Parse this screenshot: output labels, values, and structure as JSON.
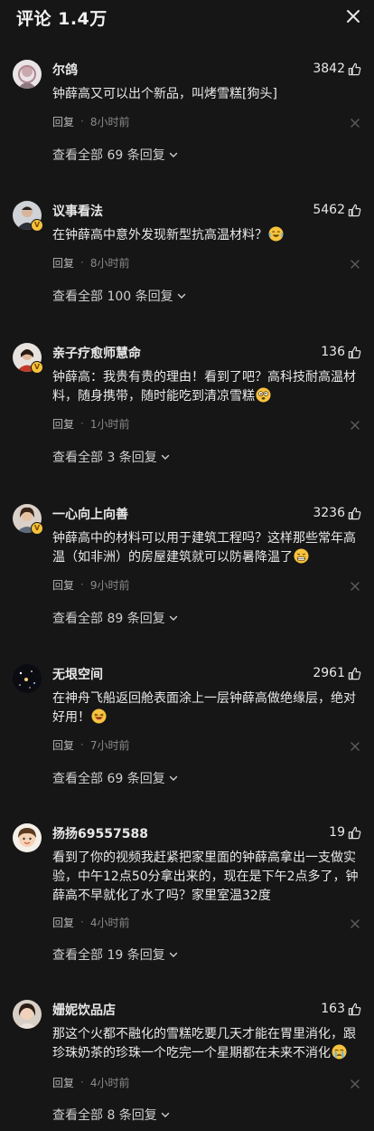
{
  "header": {
    "title": "评论 1.4万"
  },
  "labels": {
    "reply": "回复",
    "dot": "·"
  },
  "comments": [
    {
      "user": "尔鸽",
      "likes": "3842",
      "text": "钟薛高又可以出个新品，叫烤雪糕[狗头]",
      "time": "8小时前",
      "view_all": "查看全部 69 条回复",
      "emoji": "",
      "verified": false
    },
    {
      "user": "议事看法",
      "likes": "5462",
      "text": "在钟薛高中意外发现新型抗高温材料？",
      "time": "8小时前",
      "view_all": "查看全部 100 条回复",
      "emoji": "laughing-crying-emoji",
      "verified": true
    },
    {
      "user": "亲子疗愈师慧命",
      "likes": "136",
      "text": "钟薛高：我贵有贵的理由！看到了吧？高科技耐高温材料，随身携带，随时能吃到清凉雪糕",
      "time": "1小时前",
      "view_all": "查看全部 3 条回复",
      "emoji": "dizzy-emoji",
      "verified": true
    },
    {
      "user": "一心向上向善",
      "likes": "3236",
      "text": "钟薛高中的材料可以用于建筑工程吗？这样那些常年高温（如非洲）的房屋建筑就可以防暑降温了",
      "time": "9小时前",
      "view_all": "查看全部 89 条回复",
      "emoji": "grin-emoji",
      "verified": true
    },
    {
      "user": "无垠空间",
      "likes": "2961",
      "text": "在神舟飞船返回舱表面涂上一层钟薛高做绝缘层，绝对好用！",
      "time": "7小时前",
      "view_all": "查看全部 69 条回复",
      "emoji": "laughing-emoji",
      "verified": false
    },
    {
      "user": "扬扬69557588",
      "likes": "19",
      "text": "看到了你的视频我赶紧把家里面的钟薛高拿出一支做实验，中午12点50分拿出来的，现在是下午2点多了，钟薛高不早就化了水了吗？家里室温32度",
      "time": "4小时前",
      "view_all": "查看全部 19 条回复",
      "emoji": "",
      "verified": false
    },
    {
      "user": "姗妮饮品店",
      "likes": "163",
      "text": "那这个火都不融化的雪糕吃要几天才能在胃里消化，跟珍珠奶茶的珍珠一个吃完一个星期都在未来不消化",
      "time": "4小时前",
      "view_all": "查看全部 8 条回复",
      "emoji": "crying-emoji",
      "verified": false
    }
  ]
}
